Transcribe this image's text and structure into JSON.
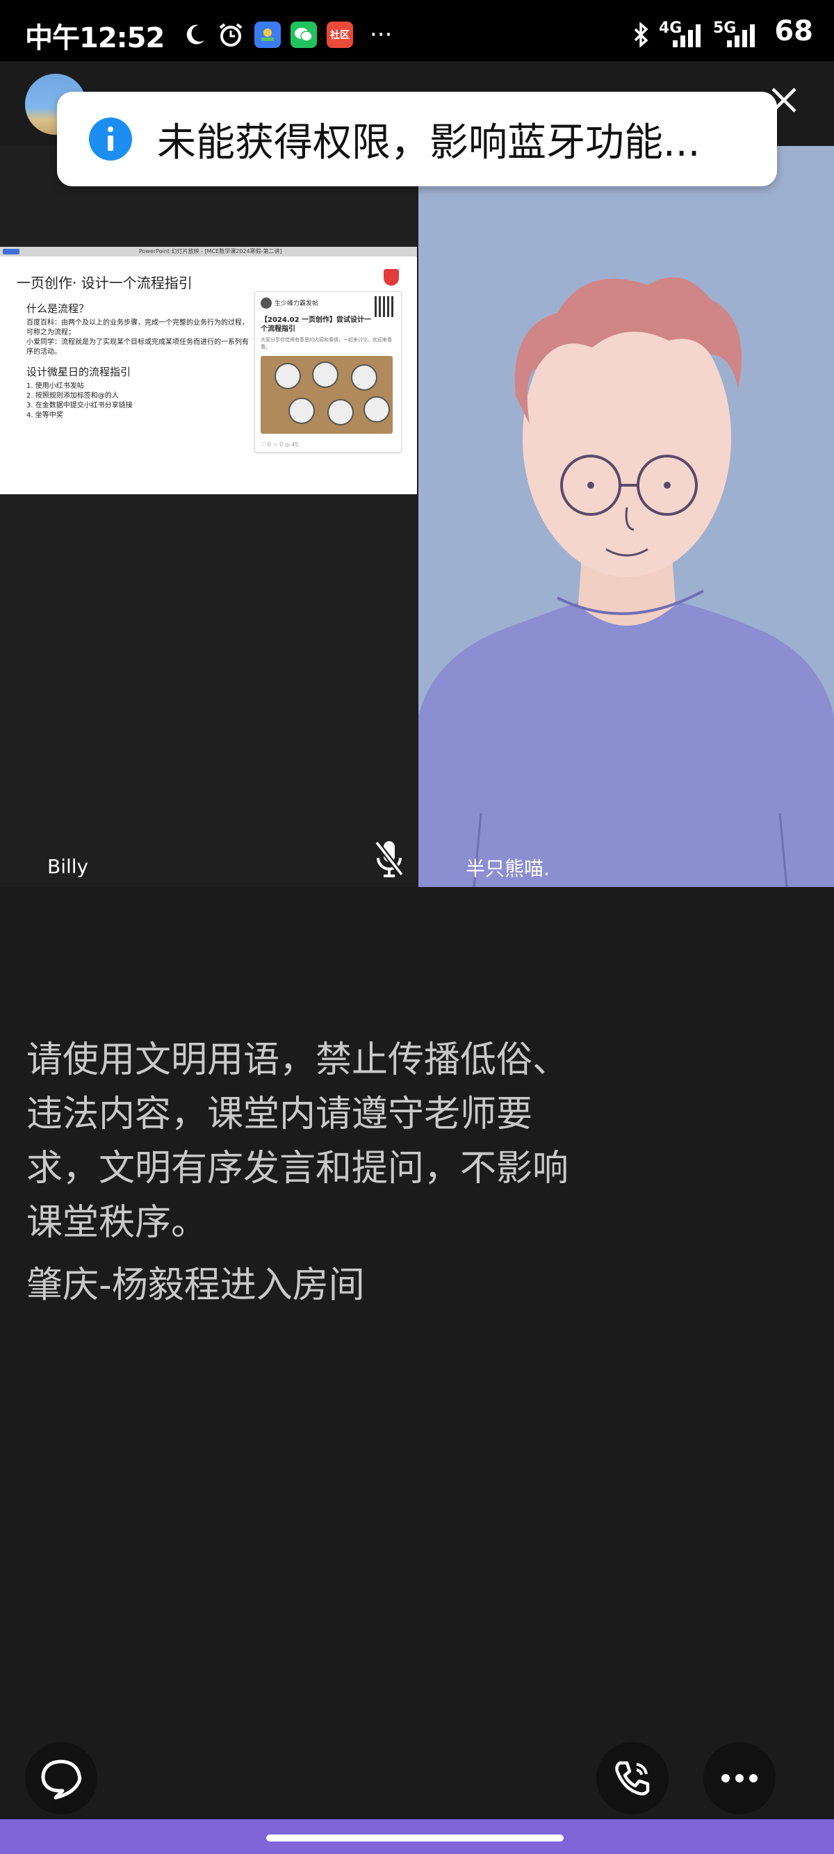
{
  "status_bar": {
    "time": "中午12:52",
    "app_icons": [
      "moon-icon",
      "alarm-icon",
      "gallery-icon",
      "wechat-icon",
      "community-app-icon"
    ],
    "community_label": "社区",
    "overflow": "···",
    "net_4g": "4G",
    "net_5g": "5G",
    "battery": "68"
  },
  "toast": {
    "text": "未能获得权限，影响蓝牙功能..."
  },
  "participants": [
    {
      "name": "Billy",
      "muted": true
    },
    {
      "name": "半只熊喵."
    }
  ],
  "slide": {
    "header_caption": "PowerPoint 幻灯片放映 - [MCE数学课2024寒假-第二讲]",
    "title": "一页创作· 设计一个流程指引",
    "section1_heading": "什么是流程？",
    "section1_lines": [
      "百度百科：由两个及以上的业务步骤，完成一个完整的业务行为的过程，可称之为流程；",
      "小爱同学：流程就是为了实现某个目标或完成某项任务而进行的一系列有序的活动。"
    ],
    "section2_heading": "设计微星日的流程指引",
    "section2_items": [
      "1.  使用小红书发帖",
      "2.  按照规则添加标签和@的人",
      "3.  在金数据中提交小红书分享链接",
      "4.  坐等中奖"
    ],
    "card": {
      "author": "生少峰力霸发帖",
      "title": "【2024.02 一页创作】尝试设计一个流程指引",
      "desc": "大家分享你觉得有意思的内容和事情，一起来讨论。欢迎来看看。",
      "foot": "♡ 0   ☆ 0   ◎ 45"
    }
  },
  "chat": {
    "notice": "请使用文明用语，禁止传播低俗、违法内容，课堂内请遵守老师要求，文明有序发言和提问，不影响课堂秩序。",
    "join_message": "肇庆-杨毅程进入房间"
  },
  "controls": [
    "chat-bubble-icon",
    "phone-call-icon",
    "more-icon"
  ],
  "colors": {
    "background": "#1b1b1b",
    "toast_icon": "#1c8ef1",
    "nav_bar": "#7f66d8",
    "avatar_bg": "#9eb0d0"
  }
}
